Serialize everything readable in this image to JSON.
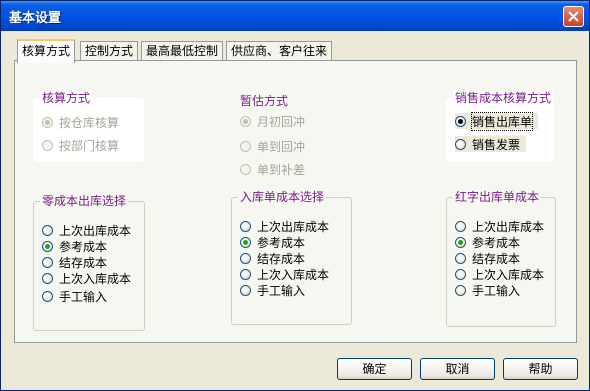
{
  "window": {
    "title": "基本设置"
  },
  "tabs": [
    {
      "label": "核算方式",
      "active": true
    },
    {
      "label": "控制方式",
      "active": false
    },
    {
      "label": "最高最低控制",
      "active": false
    },
    {
      "label": "供应商、客户往来",
      "active": false
    }
  ],
  "groups": {
    "accounting": {
      "title": "核算方式",
      "options": [
        {
          "label": "按仓库核算",
          "checked": true,
          "disabled": true
        },
        {
          "label": "按部门核算",
          "checked": false,
          "disabled": true
        }
      ]
    },
    "estimate": {
      "title": "暂估方式",
      "options": [
        {
          "label": "月初回冲",
          "checked": true,
          "disabled": true
        },
        {
          "label": "单到回冲",
          "checked": false,
          "disabled": true
        },
        {
          "label": "单到补差",
          "checked": false,
          "disabled": true
        }
      ]
    },
    "sales_cost": {
      "title": "销售成本核算方式",
      "options": [
        {
          "label": "销售出库单",
          "checked": true,
          "focused": true
        },
        {
          "label": "销售发票",
          "checked": false
        }
      ]
    },
    "zero_cost": {
      "title": "零成本出库选择",
      "options": [
        {
          "label": "上次出库成本",
          "checked": false
        },
        {
          "label": "参考成本",
          "checked": true
        },
        {
          "label": "结存成本",
          "checked": false
        },
        {
          "label": "上次入库成本",
          "checked": false
        },
        {
          "label": "手工输入",
          "checked": false
        }
      ]
    },
    "inbound_cost": {
      "title": "入库单成本选择",
      "options": [
        {
          "label": "上次出库成本",
          "checked": false
        },
        {
          "label": "参考成本",
          "checked": true
        },
        {
          "label": "结存成本",
          "checked": false
        },
        {
          "label": "上次入库成本",
          "checked": false
        },
        {
          "label": "手工输入",
          "checked": false
        }
      ]
    },
    "red_cost": {
      "title": "红字出库单成本",
      "options": [
        {
          "label": "上次出库成本",
          "checked": false
        },
        {
          "label": "参考成本",
          "checked": true
        },
        {
          "label": "结存成本",
          "checked": false
        },
        {
          "label": "上次入库成本",
          "checked": false
        },
        {
          "label": "手工输入",
          "checked": false
        }
      ]
    }
  },
  "buttons": {
    "ok": "确定",
    "cancel": "取消",
    "help": "帮助"
  },
  "colors": {
    "titlebar": "#0054e3",
    "group_title": "#7a1e8c",
    "radio_check": "#21a121"
  }
}
